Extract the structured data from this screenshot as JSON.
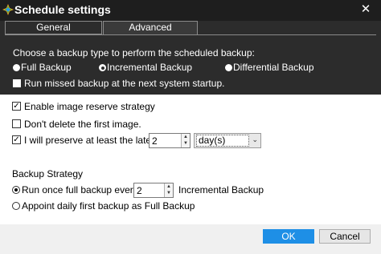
{
  "window": {
    "title": "Schedule settings",
    "close_glyph": "✕",
    "app_icon": "colorful-logo-icon"
  },
  "tabs": [
    {
      "label": "General",
      "selected": false
    },
    {
      "label": "Advanced",
      "selected": true
    }
  ],
  "backup_type": {
    "prompt": "Choose a backup type to perform the scheduled backup:",
    "options": [
      {
        "label": "Full Backup",
        "selected": false
      },
      {
        "label": "Incremental Backup",
        "selected": true
      },
      {
        "label": "Differential Backup",
        "selected": false
      }
    ],
    "run_missed_label": "Run missed backup at the next system startup.",
    "run_missed_checked": false
  },
  "reserve": {
    "enable_label": "Enable image reserve strategy",
    "enable_checked": true,
    "dont_delete_label": "Don't delete the first image.",
    "dont_delete_checked": false,
    "preserve_label": "I will preserve at least the latest",
    "preserve_checked": true,
    "preserve_value": "2",
    "preserve_unit": "day(s)"
  },
  "strategy": {
    "heading": "Backup Strategy",
    "run_once_label": "Run once full backup every",
    "run_once_selected": true,
    "run_once_value": "2",
    "run_once_suffix": "Incremental Backup",
    "appoint_label": "Appoint daily first backup as Full Backup",
    "appoint_selected": false
  },
  "buttons": {
    "ok": "OK",
    "cancel": "Cancel"
  },
  "colors": {
    "title_bar": "#1e1e1e",
    "dark_panel": "#2c2c2c",
    "accent": "#1e8fe6"
  },
  "glyphs": {
    "check": "✓",
    "up": "▲",
    "down": "▼",
    "chevron": "⌄"
  }
}
